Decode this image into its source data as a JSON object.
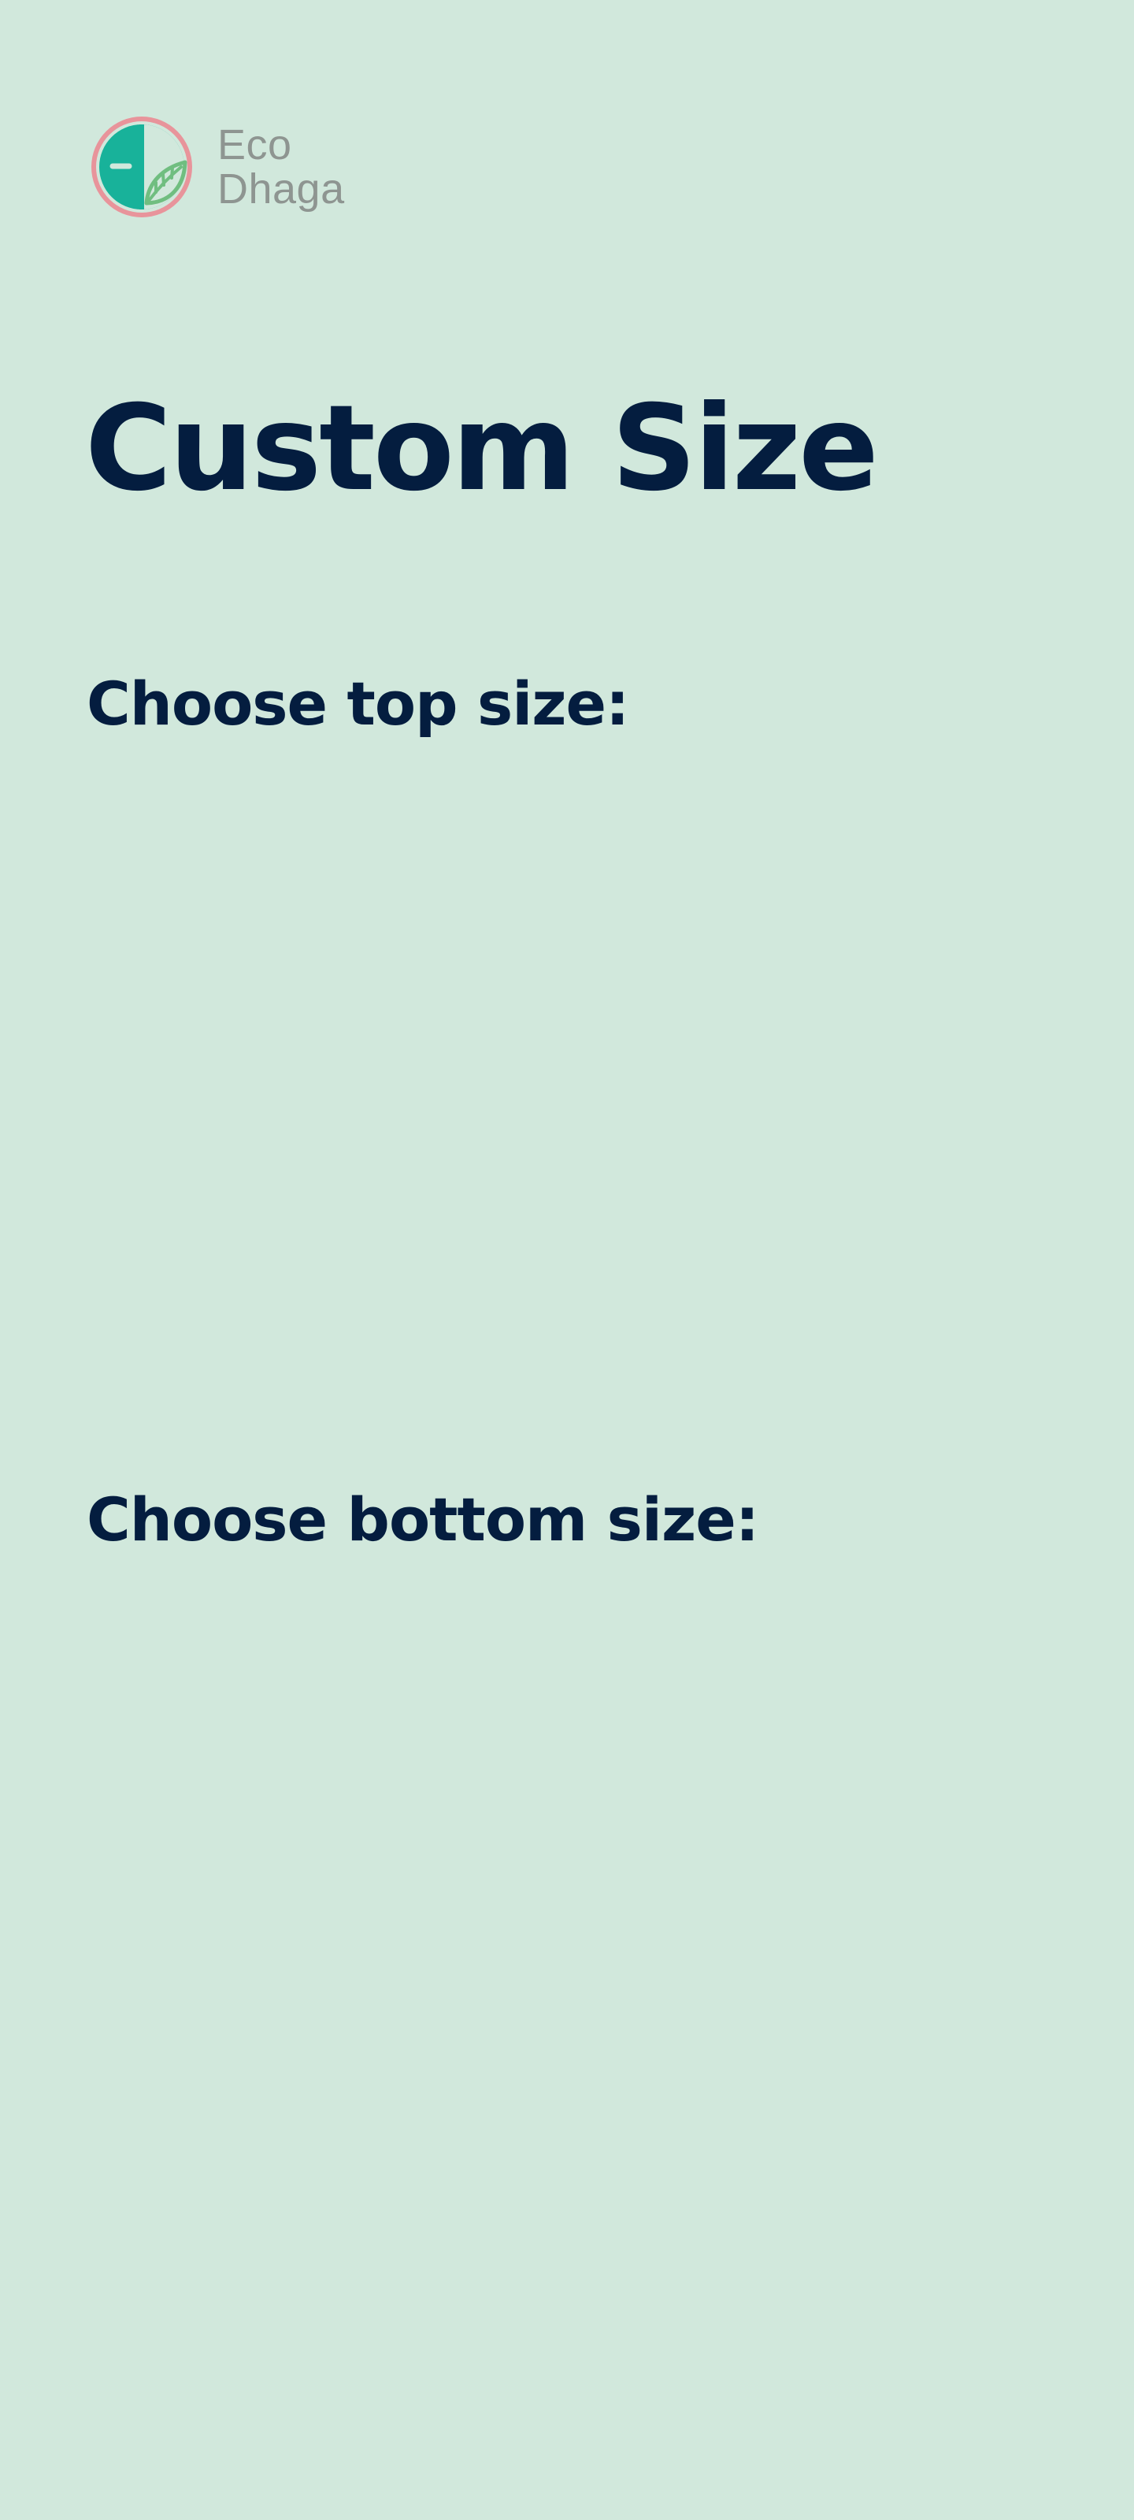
{
  "brand": {
    "line1": "Eco",
    "line2": "Dhaga",
    "colors": {
      "ring": "#e8949b",
      "primary": "#18b29a",
      "leaf": "#70be80",
      "text": "#8e9591"
    }
  },
  "page": {
    "title": "Custom Size",
    "background": "#d1e8dc",
    "text_color": "#041d3f"
  },
  "sections": {
    "top": {
      "label": "Choose top size:"
    },
    "bottom": {
      "label": "Choose bottom size:"
    }
  }
}
